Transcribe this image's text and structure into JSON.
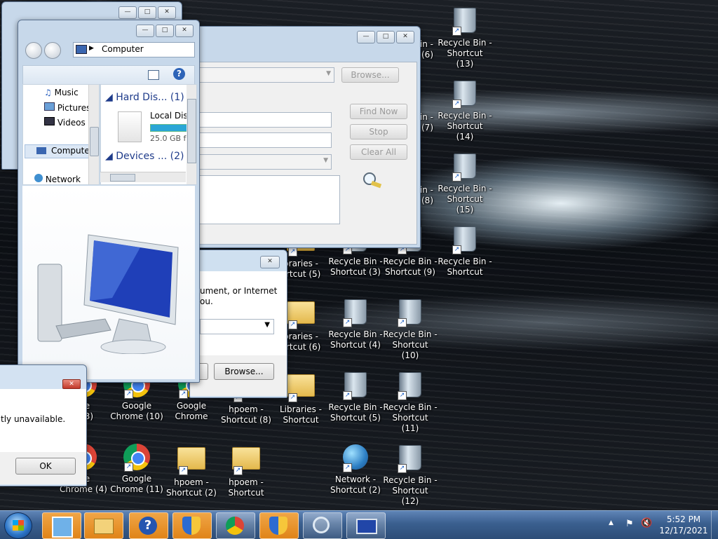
{
  "desktop_icons": [
    {
      "id": "rb13",
      "lines": [
        "Recycle Bin -",
        "Shortcut (13)"
      ],
      "type": "bin"
    },
    {
      "id": "rb14",
      "lines": [
        "Recycle Bin -",
        "Shortcut (14)"
      ],
      "type": "bin"
    },
    {
      "id": "rb15",
      "lines": [
        "Recycle Bin -",
        "Shortcut (15)"
      ],
      "type": "bin"
    },
    {
      "id": "rb",
      "lines": [
        "Recycle Bin -",
        "Shortcut"
      ],
      "type": "bin"
    },
    {
      "id": "rb3",
      "lines": [
        "Recycle Bin -",
        "Shortcut (3)"
      ],
      "type": "bin"
    },
    {
      "id": "rb9",
      "lines": [
        "Recycle Bin -",
        "Shortcut (9)"
      ],
      "type": "bin"
    },
    {
      "id": "rb4",
      "lines": [
        "Recycle Bin -",
        "Shortcut (4)"
      ],
      "type": "bin"
    },
    {
      "id": "rb10",
      "lines": [
        "Recycle Bin -",
        "Shortcut (10)"
      ],
      "type": "bin"
    },
    {
      "id": "rb5",
      "lines": [
        "Recycle Bin -",
        "Shortcut (5)"
      ],
      "type": "bin"
    },
    {
      "id": "rb11",
      "lines": [
        "Recycle Bin -",
        "Shortcut (11)"
      ],
      "type": "bin"
    },
    {
      "id": "rb12",
      "lines": [
        "Recycle Bin -",
        "Shortcut (12)"
      ],
      "type": "bin"
    },
    {
      "id": "lib5",
      "lines": [
        "braries -",
        "ortcut (5)"
      ],
      "type": "folder"
    },
    {
      "id": "lib6",
      "lines": [
        "braries -",
        "ortcut (6)"
      ],
      "type": "folder"
    },
    {
      "id": "lib",
      "lines": [
        "Libraries -",
        "Shortcut"
      ],
      "type": "folder"
    },
    {
      "id": "net2",
      "lines": [
        "Network -",
        "Shortcut (2)"
      ],
      "type": "globe"
    },
    {
      "id": "gc10",
      "lines": [
        "Google",
        "Chrome (10)"
      ],
      "type": "chrome"
    },
    {
      "id": "gc",
      "lines": [
        "Google",
        "Chrome"
      ],
      "type": "chrome"
    },
    {
      "id": "gc11",
      "lines": [
        "Google",
        "Chrome (11)"
      ],
      "type": "chrome"
    },
    {
      "id": "gc3",
      "lines": [
        "gle",
        "e (3)"
      ],
      "type": "chrome"
    },
    {
      "id": "gc4",
      "lines": [
        "gle",
        "Chrome (4)"
      ],
      "type": "chrome"
    },
    {
      "id": "hp8",
      "lines": [
        "hpoem -",
        "Shortcut (8)"
      ],
      "type": "folder"
    },
    {
      "id": "hp2",
      "lines": [
        "hpoem -",
        "Shortcut (2)"
      ],
      "type": "folder"
    },
    {
      "id": "hp",
      "lines": [
        "hpoem -",
        "Shortcut"
      ],
      "type": "folder"
    },
    {
      "id": "s6",
      "lines": [
        "",
        "Shortcut (6)"
      ],
      "type": "none"
    },
    {
      "id": "c6",
      "lines": [
        "in -",
        "(6)"
      ],
      "type": "none"
    },
    {
      "id": "c7",
      "lines": [
        "in -",
        "(7)"
      ],
      "type": "none"
    },
    {
      "id": "c8",
      "lines": [
        "in -",
        "(8)"
      ],
      "type": "none"
    }
  ],
  "explorer": {
    "address": "Computer",
    "nav": [
      "Music",
      "Pictures",
      "Videos",
      "Compute",
      "Network"
    ],
    "groups": [
      "Hard Dis... (1)",
      "Devices ... (2)"
    ],
    "drive_name": "Local Dis",
    "drive_size": "25.0 GB f"
  },
  "search_window": {
    "browse": "Browse...",
    "find_now": "Find Now",
    "stop": "Stop",
    "clear_all": "Clear All"
  },
  "run_dialog": {
    "text1": "ument, or Internet",
    "text2": "ou.",
    "browse": "Browse..."
  },
  "error_dialog": {
    "message": "tly unavailable.",
    "ok": "OK"
  },
  "tray": {
    "time": "5:52 PM",
    "date": "12/17/2021"
  }
}
